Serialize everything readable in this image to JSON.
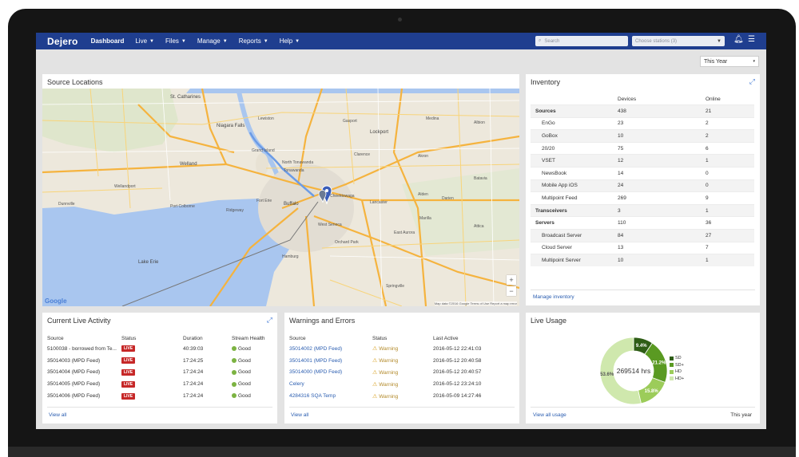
{
  "colors": {
    "nav": "#1f3e8f",
    "link": "#2a5db0",
    "live": "#c62828",
    "good": "#7cb342",
    "warning": "#d8a020",
    "sd": "#2e5d16",
    "sd_plus": "#5a9a22",
    "hd": "#9ccc5a",
    "hd_plus": "#cfe8ad"
  },
  "nav": {
    "brand": "Dejero",
    "items": [
      "Dashboard",
      "Live",
      "Files",
      "Manage",
      "Reports",
      "Help"
    ],
    "search_placeholder": "Search",
    "stations_placeholder": "Choose stations (3)"
  },
  "period": "This Year",
  "map": {
    "title": "Source Locations",
    "labels": [
      "St. Catharines",
      "Niagara Falls",
      "Lewiston",
      "Grand Island",
      "North Tonawanda",
      "Tonawanda",
      "Lockport",
      "Gasport",
      "Medina",
      "Clarence",
      "Akron",
      "Welland",
      "Port Colborne",
      "Fort Erie",
      "Buffalo",
      "Cheektowaga",
      "Lancaster",
      "Alden",
      "West Seneca",
      "Orchard Park",
      "East Aurora",
      "Hamburg",
      "Lake Erie",
      "Springville",
      "Wellandport",
      "Dunnville",
      "Attica",
      "Batavia",
      "Albion",
      "Ridgeway",
      "Marilla",
      "Darien"
    ],
    "google": "Google",
    "attribution": "Map data ©2016 Google   Terms of Use   Report a map error"
  },
  "inventory": {
    "title": "Inventory",
    "columns": [
      "",
      "Devices",
      "Online"
    ],
    "rows": [
      {
        "name": "Sources",
        "devices": "438",
        "online": "21",
        "level": "top"
      },
      {
        "name": "EnGo",
        "devices": "23",
        "online": "2",
        "level": "sub"
      },
      {
        "name": "GoBox",
        "devices": "10",
        "online": "2",
        "level": "sub"
      },
      {
        "name": "20/20",
        "devices": "75",
        "online": "6",
        "level": "sub"
      },
      {
        "name": "VSET",
        "devices": "12",
        "online": "1",
        "level": "sub"
      },
      {
        "name": "NewsBook",
        "devices": "14",
        "online": "0",
        "level": "sub"
      },
      {
        "name": "Mobile App iOS",
        "devices": "24",
        "online": "0",
        "level": "sub"
      },
      {
        "name": "Multipoint Feed",
        "devices": "269",
        "online": "9",
        "level": "sub"
      },
      {
        "name": "Transceivers",
        "devices": "3",
        "online": "1",
        "level": "top"
      },
      {
        "name": "Servers",
        "devices": "110",
        "online": "36",
        "level": "top"
      },
      {
        "name": "Broadcast Server",
        "devices": "84",
        "online": "27",
        "level": "sub"
      },
      {
        "name": "Cloud Server",
        "devices": "13",
        "online": "7",
        "level": "sub"
      },
      {
        "name": "Multipoint Server",
        "devices": "10",
        "online": "1",
        "level": "sub"
      }
    ],
    "manage_link": "Manage inventory"
  },
  "live_activity": {
    "title": "Current Live Activity",
    "columns": [
      "Source",
      "Status",
      "Duration",
      "Stream Health"
    ],
    "rows": [
      {
        "source": "5100038 - borrowed from Te...",
        "status": "LIVE",
        "duration": "40:39:03",
        "health": "Good"
      },
      {
        "source": "35014003 (MPD Feed)",
        "status": "LIVE",
        "duration": "17:24:25",
        "health": "Good"
      },
      {
        "source": "35014004 (MPD Feed)",
        "status": "LIVE",
        "duration": "17:24:24",
        "health": "Good"
      },
      {
        "source": "35014005 (MPD Feed)",
        "status": "LIVE",
        "duration": "17:24:24",
        "health": "Good"
      },
      {
        "source": "35014006 (MPD Feed)",
        "status": "LIVE",
        "duration": "17:24:24",
        "health": "Good"
      }
    ],
    "view_all": "View all"
  },
  "warnings": {
    "title": "Warnings and Errors",
    "columns": [
      "Source",
      "Status",
      "Last Active"
    ],
    "rows": [
      {
        "source": "35014002 (MPD Feed)",
        "status": "Warning",
        "last": "2016-05-12 22:41:03"
      },
      {
        "source": "35014001 (MPD Feed)",
        "status": "Warning",
        "last": "2016-05-12 20:40:58"
      },
      {
        "source": "35014000 (MPD Feed)",
        "status": "Warning",
        "last": "2016-05-12 20:40:57"
      },
      {
        "source": "Celery",
        "status": "Warning",
        "last": "2016-05-12 23:24:10"
      },
      {
        "source": "4284316 SQA Temp",
        "status": "Warning",
        "last": "2016-05-09 14:27:46"
      }
    ],
    "view_all": "View all"
  },
  "usage": {
    "title": "Live Usage",
    "center": "269514 hrs",
    "view_all": "View all usage",
    "period": "This year"
  },
  "chart_data": {
    "type": "pie",
    "title": "Live Usage",
    "center_label": "269514 hrs",
    "categories": [
      "SD",
      "SD+",
      "HD",
      "HD+"
    ],
    "values": [
      9.4,
      21.2,
      15.8,
      53.6
    ],
    "value_labels": [
      "9.4%",
      "21.2%",
      "15.8%",
      "53.6%"
    ],
    "legend": "right"
  }
}
